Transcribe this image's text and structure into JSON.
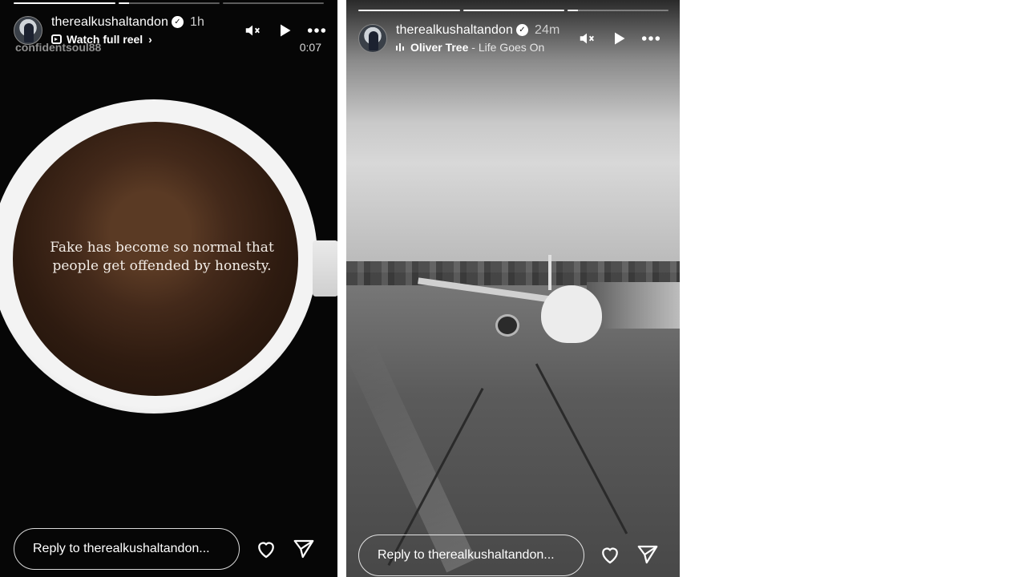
{
  "stories": [
    {
      "username": "therealkushaltandon",
      "time": "1h",
      "subline": "Watch full reel",
      "overlay_tag": "confidentsoul88",
      "duration": "0:07",
      "quote": "Fake has become so normal that people get offended by honesty.",
      "reply_placeholder": "Reply to therealkushaltandon...",
      "progress": [
        1.0,
        0.1,
        0.0
      ]
    },
    {
      "username": "therealkushaltandon",
      "time": "24m",
      "music_artist": "Oliver Tree",
      "music_song": "Life Goes On",
      "reply_placeholder": "Reply to therealkushaltandon...",
      "progress": [
        1.0,
        1.0,
        0.1
      ]
    }
  ],
  "separator": " - ",
  "icons": [
    "avatar",
    "verified-icon",
    "reel-icon",
    "chevron-right-icon",
    "mute-icon",
    "play-icon",
    "more-icon",
    "music-icon",
    "heart-icon",
    "send-icon"
  ]
}
